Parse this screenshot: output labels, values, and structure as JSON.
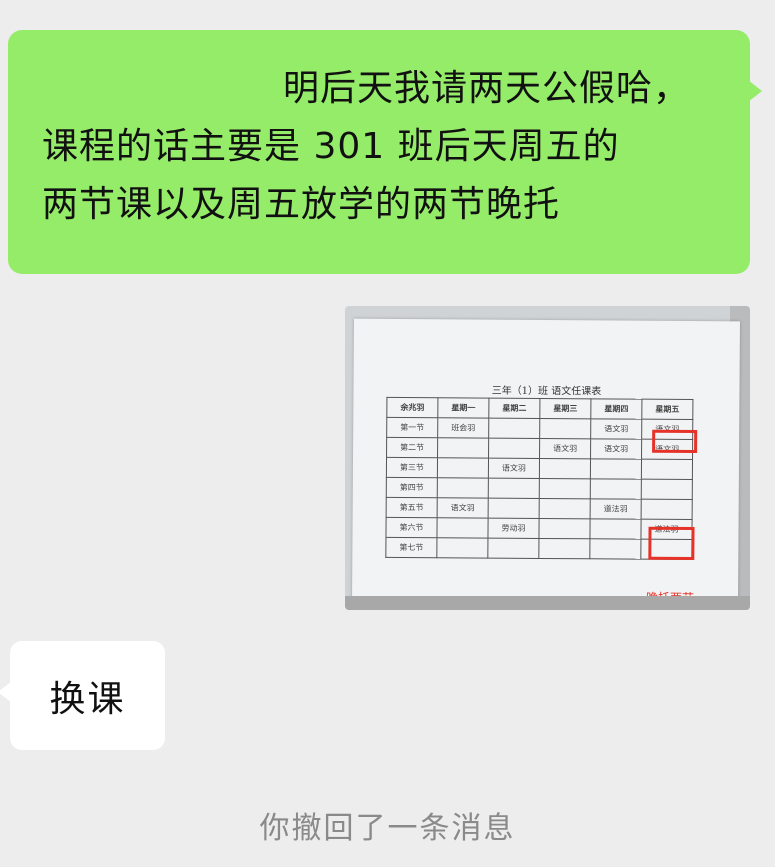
{
  "messages": {
    "outgoing_text_lines": [
      "明后天我请两天公假哈，",
      "课程的话主要是 301 班后天周五的",
      "两节课以及周五放学的两节晚托"
    ],
    "incoming_text": "换课",
    "system_notice": "你撤回了一条消息"
  },
  "photo": {
    "title": "三年（1）班 语文任课表",
    "header": [
      "余兆羽",
      "星期一",
      "星期二",
      "星期三",
      "星期四",
      "星期五"
    ],
    "rows": [
      [
        "第一节",
        "班会羽",
        "",
        "",
        "语文羽",
        "语文羽"
      ],
      [
        "第二节",
        "",
        "",
        "语文羽",
        "语文羽",
        "语文羽"
      ],
      [
        "第三节",
        "",
        "语文羽",
        "",
        "",
        ""
      ],
      [
        "第四节",
        "",
        "",
        "",
        "",
        ""
      ],
      [
        "第五节",
        "语文羽",
        "",
        "",
        "道法羽",
        ""
      ],
      [
        "第六节",
        "",
        "劳动羽",
        "",
        "",
        "道法羽"
      ],
      [
        "第七节",
        "",
        "",
        "",
        "",
        ""
      ]
    ],
    "annotation": "晚托两节",
    "highlight_color": "#e6332a"
  },
  "colors": {
    "background": "#ededed",
    "outgoing_bubble": "#95ec69",
    "incoming_bubble": "#ffffff",
    "system_text": "#8a8a8a"
  }
}
